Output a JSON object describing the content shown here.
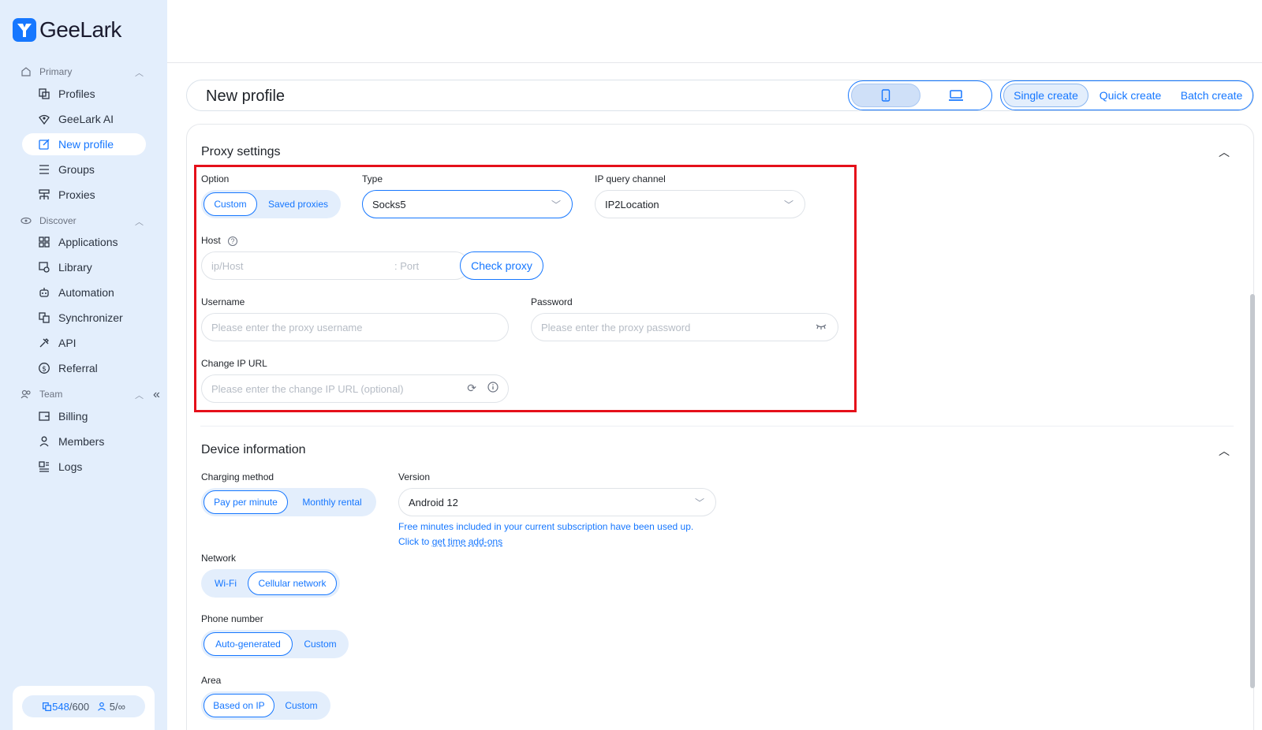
{
  "app": {
    "name": "GeeLark"
  },
  "sidebar": {
    "sections": [
      {
        "label": "Primary",
        "items": [
          {
            "label": "Profiles",
            "icon": "profiles-icon"
          },
          {
            "label": "GeeLark AI",
            "icon": "ai-icon"
          },
          {
            "label": "New profile",
            "icon": "edit-icon",
            "active": true
          },
          {
            "label": "Groups",
            "icon": "list-icon"
          },
          {
            "label": "Proxies",
            "icon": "proxies-icon"
          }
        ]
      },
      {
        "label": "Discover",
        "items": [
          {
            "label": "Applications",
            "icon": "apps-icon"
          },
          {
            "label": "Library",
            "icon": "library-icon"
          },
          {
            "label": "Automation",
            "icon": "robot-icon"
          },
          {
            "label": "Synchronizer",
            "icon": "sync-icon"
          },
          {
            "label": "API",
            "icon": "api-icon"
          },
          {
            "label": "Referral",
            "icon": "dollar-icon"
          }
        ]
      },
      {
        "label": "Team",
        "items": [
          {
            "label": "Billing",
            "icon": "billing-icon"
          },
          {
            "label": "Members",
            "icon": "user-icon"
          },
          {
            "label": "Logs",
            "icon": "logs-icon"
          }
        ]
      }
    ],
    "quota": {
      "profiles_used": "548",
      "profiles_total": "/600",
      "members": "5/∞"
    }
  },
  "header": {
    "title": "New profile",
    "create_modes": [
      "Single create",
      "Quick create",
      "Batch create"
    ],
    "selected_mode": "Single create"
  },
  "proxy": {
    "title": "Proxy settings",
    "option_label": "Option",
    "options": [
      "Custom",
      "Saved proxies"
    ],
    "type_label": "Type",
    "type_value": "Socks5",
    "channel_label": "IP query channel",
    "channel_value": "IP2Location",
    "host_label": "Host",
    "host_placeholder": "ip/Host",
    "port_placeholder": ": Port",
    "check_label": "Check proxy",
    "username_label": "Username",
    "username_placeholder": "Please enter the proxy username",
    "password_label": "Password",
    "password_placeholder": "Please enter the proxy password",
    "change_ip_label": "Change IP URL",
    "change_ip_placeholder": "Please enter the change IP URL (optional)"
  },
  "device": {
    "title": "Device information",
    "charging_label": "Charging method",
    "charging_options": [
      "Pay per minute",
      "Monthly rental"
    ],
    "version_label": "Version",
    "version_value": "Android 12",
    "note_text": "Free minutes included in your current subscription have been used up. Click to ",
    "note_link": "get time add-ons",
    "network_label": "Network",
    "network_options": [
      "Wi-Fi",
      "Cellular network"
    ],
    "phone_label": "Phone number",
    "phone_options": [
      "Auto-generated",
      "Custom"
    ],
    "area_label": "Area",
    "area_options": [
      "Based on IP",
      "Custom"
    ]
  },
  "colors": {
    "accent": "#1677ff",
    "sidebar_bg": "#e3eefc",
    "highlight": "#e5101a"
  }
}
